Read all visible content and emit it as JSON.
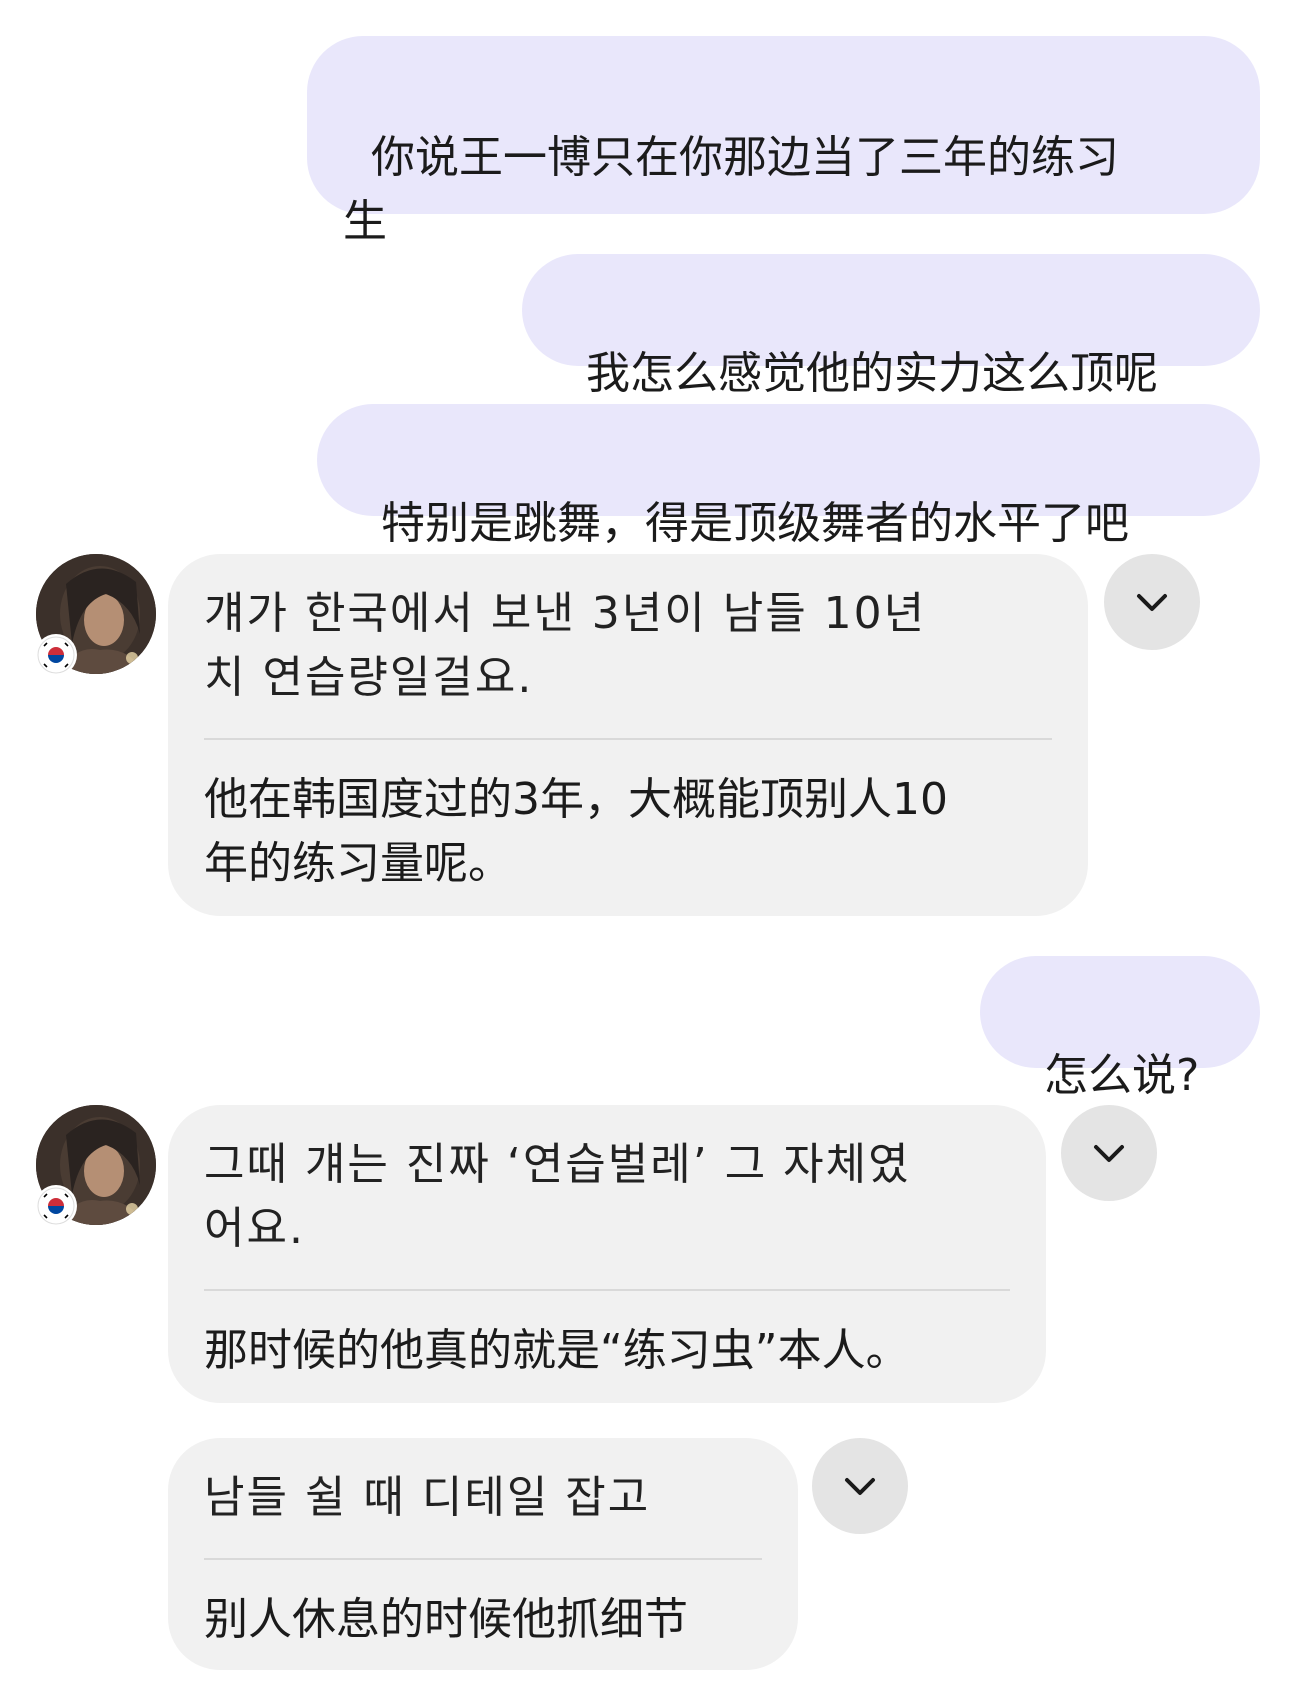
{
  "messages": {
    "m1": {
      "text": "你说王一博只在你那边当了三年的练习\n生"
    },
    "m2": {
      "text": "我怎么感觉他的实力这么顶呢"
    },
    "m3": {
      "text": "特别是跳舞，得是顶级舞者的水平了吧"
    },
    "m4": {
      "original": "걔가 한국에서 보낸 3년이 남들 10년\n치 연습량일걸요.",
      "translation": "他在韩国度过的3年，大概能顶别人10\n年的练习量呢。"
    },
    "m5": {
      "text": "怎么说?"
    },
    "m6": {
      "original": "그때 걔는 진짜 ‘연습벌레’ 그 자체였\n어요.",
      "translation": "那时候的他真的就是“练习虫”本人。"
    },
    "m7": {
      "original": "남들 쉴 때 디테일 잡고",
      "translation": "别人休息的时候他抓细节"
    }
  },
  "icons": {
    "avatar": "avatar-photo",
    "flag": "south-korea-flag-icon",
    "expand": "chevron-down-icon"
  },
  "colors": {
    "outgoing_bubble": "#e9e7fb",
    "incoming_bubble": "#f1f1f1",
    "button_bg": "#e4e4e4"
  }
}
